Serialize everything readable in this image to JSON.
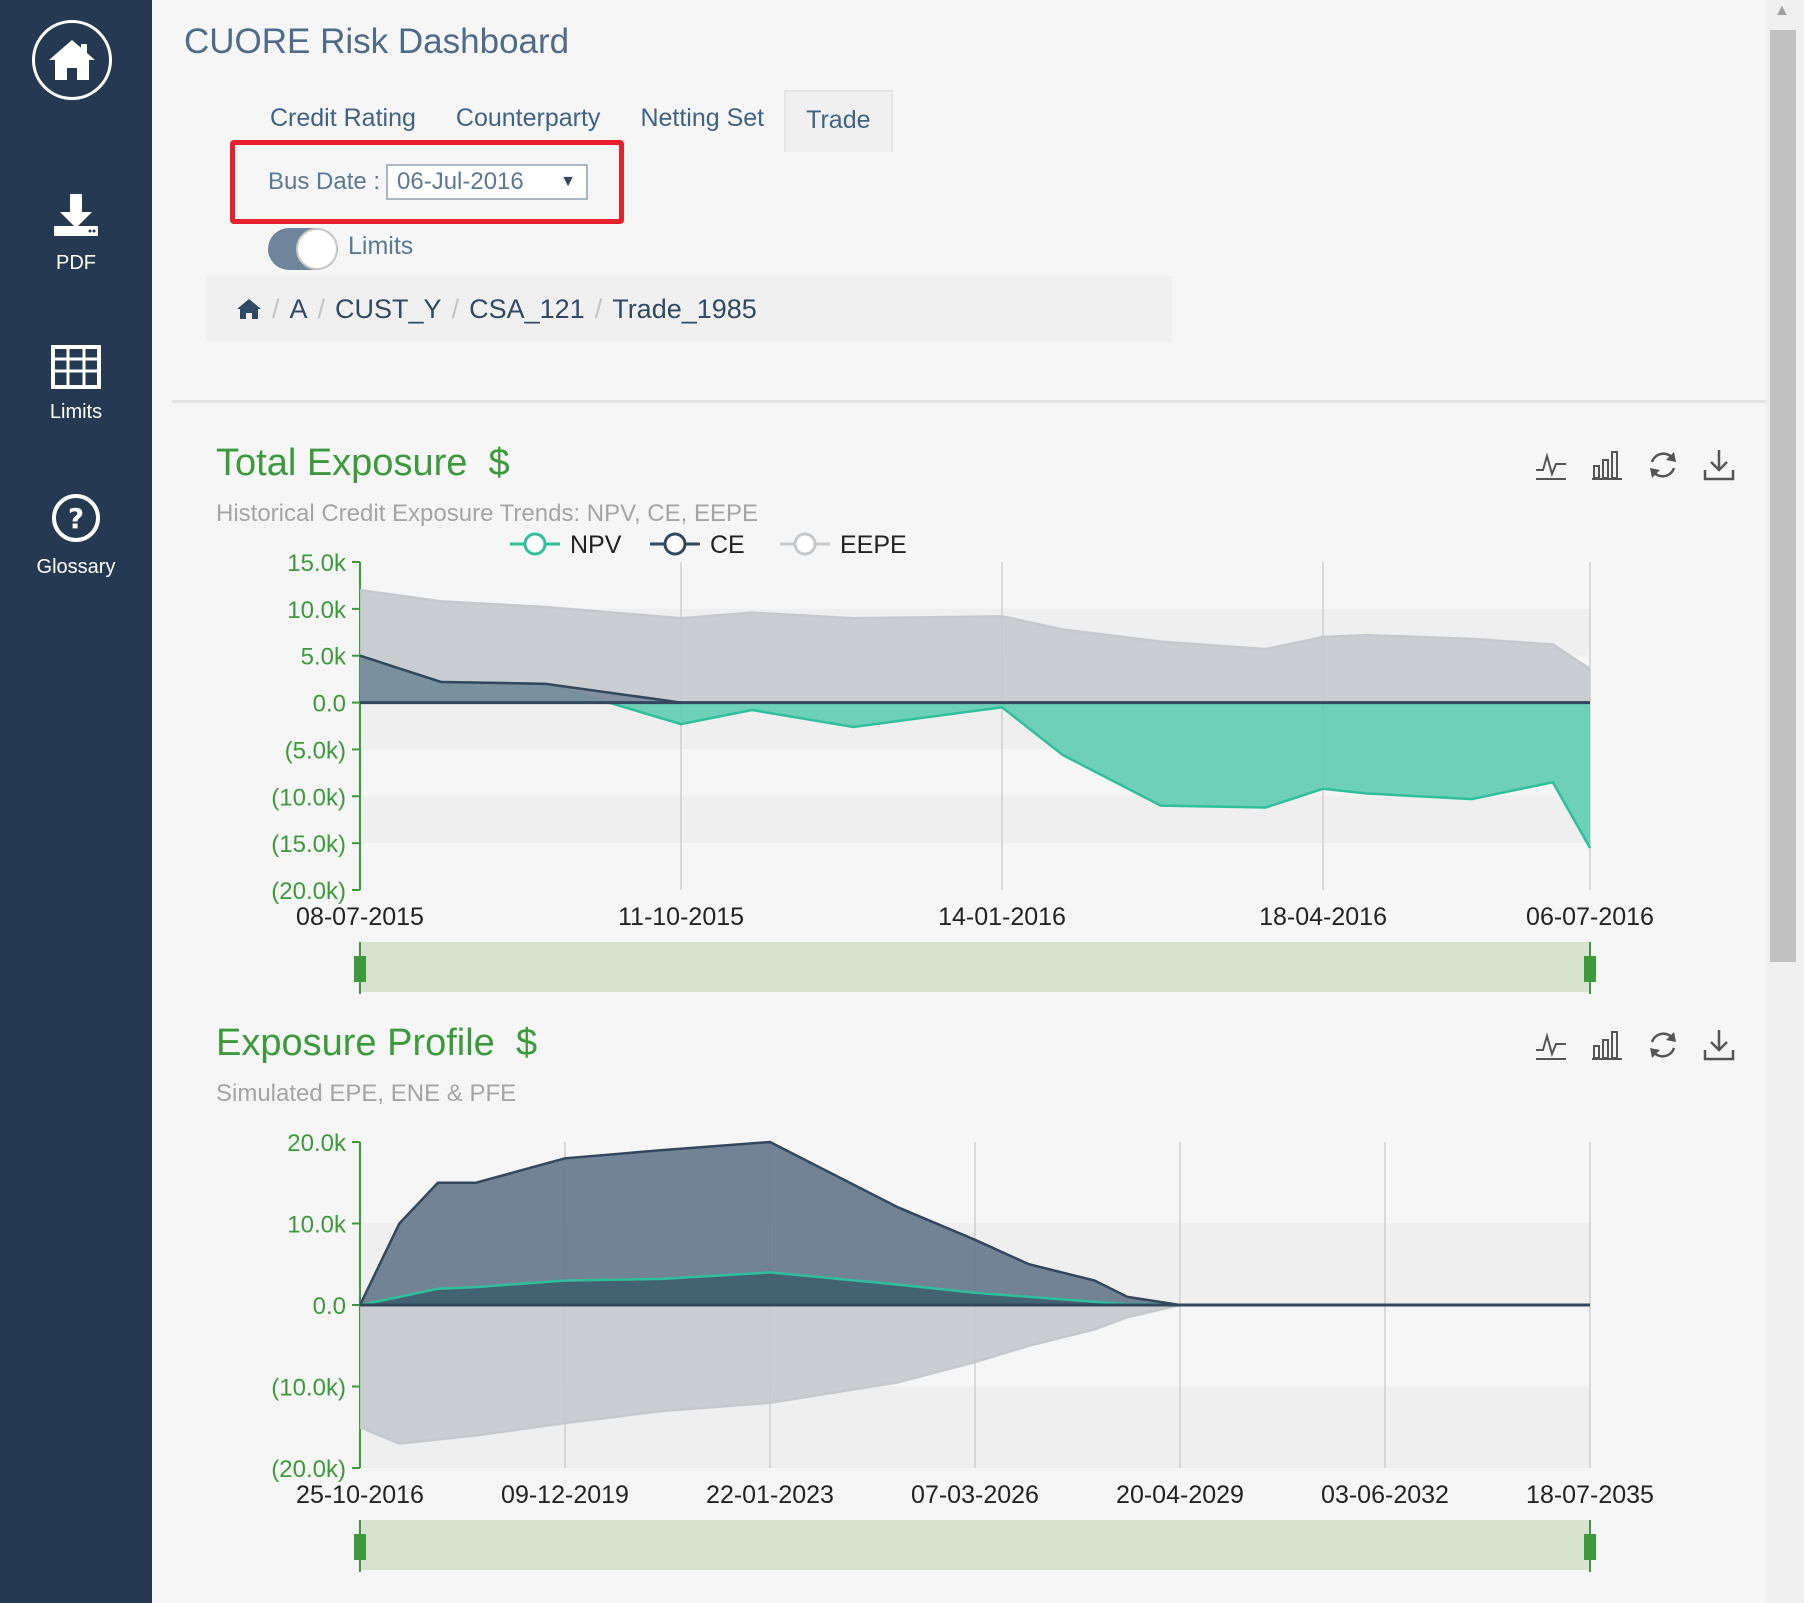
{
  "app": {
    "title": "CUORE Risk Dashboard"
  },
  "sidebar": {
    "items": [
      {
        "label": "PDF",
        "icon": "download-icon"
      },
      {
        "label": "Limits",
        "icon": "grid-table-icon"
      },
      {
        "label": "Glossary",
        "icon": "question-circle-icon"
      }
    ],
    "home_icon": "home-icon"
  },
  "tabs": [
    {
      "label": "Credit Rating",
      "active": false
    },
    {
      "label": "Counterparty",
      "active": false
    },
    {
      "label": "Netting Set",
      "active": false
    },
    {
      "label": "Trade",
      "active": true
    }
  ],
  "filters": {
    "bus_date_label": "Bus Date :",
    "bus_date_value": "06-Jul-2016",
    "limits_label": "Limits",
    "limits_on": true
  },
  "breadcrumb": [
    "A",
    "CUST_Y",
    "CSA_121",
    "Trade_1985"
  ],
  "panels": {
    "total_exposure": {
      "title": "Total Exposure",
      "currency": "$",
      "subtitle": "Historical Credit Exposure Trends: NPV, CE, EEPE"
    },
    "exposure_profile": {
      "title": "Exposure Profile",
      "currency": "$",
      "subtitle": "Simulated EPE, ENE & PFE"
    }
  },
  "toolbar_icons": [
    "line-chart-icon",
    "bar-chart-icon",
    "refresh-icon",
    "download-icon"
  ],
  "colors": {
    "sidebar": "#253a52",
    "accent_green": "#3c9a3c",
    "npv": "#2fbf9c",
    "ce": "#33475e",
    "eepe": "#c5c9ce",
    "highlight": "#e8202d"
  },
  "chart_data": [
    {
      "type": "area",
      "legend": [
        "NPV",
        "CE",
        "EEPE"
      ],
      "yticks": [
        "15.0k",
        "10.0k",
        "5.0k",
        "0.0",
        "(5.0k)",
        "(10.0k)",
        "(15.0k)",
        "(20.0k)"
      ],
      "xticks": [
        "08-07-2015",
        "11-10-2015",
        "14-01-2016",
        "18-04-2016",
        "06-07-2016"
      ],
      "ylim": [
        -20000,
        15000
      ],
      "x": [
        "08-07-2015",
        "01-08-2015",
        "01-09-2015",
        "11-10-2015",
        "01-11-2015",
        "01-12-2015",
        "14-01-2016",
        "01-02-2016",
        "01-03-2016",
        "01-04-2016",
        "18-04-2016",
        "01-05-2016",
        "01-06-2016",
        "25-06-2016",
        "06-07-2016"
      ],
      "series": [
        {
          "name": "EEPE",
          "values": [
            12000,
            10800,
            10200,
            9000,
            9600,
            9000,
            9200,
            7800,
            6500,
            5700,
            7000,
            7200,
            6800,
            6200,
            3600
          ]
        },
        {
          "name": "CE",
          "values": [
            5000,
            2200,
            2000,
            0,
            0,
            0,
            0,
            0,
            0,
            0,
            0,
            0,
            0,
            0,
            0
          ]
        },
        {
          "name": "NPV",
          "values": [
            5000,
            2200,
            2000,
            -2300,
            -800,
            -2600,
            -500,
            -5600,
            -11000,
            -11200,
            -9200,
            -9700,
            -10300,
            -8500,
            -15500
          ]
        }
      ]
    },
    {
      "type": "area",
      "yticks": [
        "20.0k",
        "10.0k",
        "0.0",
        "(10.0k)",
        "(20.0k)"
      ],
      "xticks": [
        "25-10-2016",
        "09-12-2019",
        "22-01-2023",
        "07-03-2026",
        "20-04-2029",
        "03-06-2032",
        "18-07-2035"
      ],
      "ylim": [
        -20000,
        20000
      ],
      "x": [
        "25-10-2016",
        "01-06-2017",
        "01-01-2018",
        "01-08-2018",
        "09-12-2019",
        "01-06-2021",
        "22-01-2023",
        "01-01-2025",
        "07-03-2026",
        "01-01-2027",
        "01-01-2028",
        "01-07-2028",
        "20-04-2029",
        "03-06-2032",
        "18-07-2035"
      ],
      "series": [
        {
          "name": "PFE",
          "values": [
            0,
            10000,
            15000,
            15000,
            18000,
            19000,
            20000,
            12000,
            8000,
            5000,
            3000,
            1000,
            0,
            0,
            0
          ]
        },
        {
          "name": "EPE",
          "values": [
            0,
            1000,
            2000,
            2200,
            3000,
            3200,
            4000,
            2500,
            1500,
            1000,
            400,
            100,
            0,
            0,
            0
          ]
        },
        {
          "name": "ENE",
          "values": [
            -15000,
            -17000,
            -16500,
            -16000,
            -14500,
            -13000,
            -12000,
            -9500,
            -7000,
            -5000,
            -3000,
            -1500,
            0,
            0,
            0
          ]
        }
      ]
    }
  ]
}
